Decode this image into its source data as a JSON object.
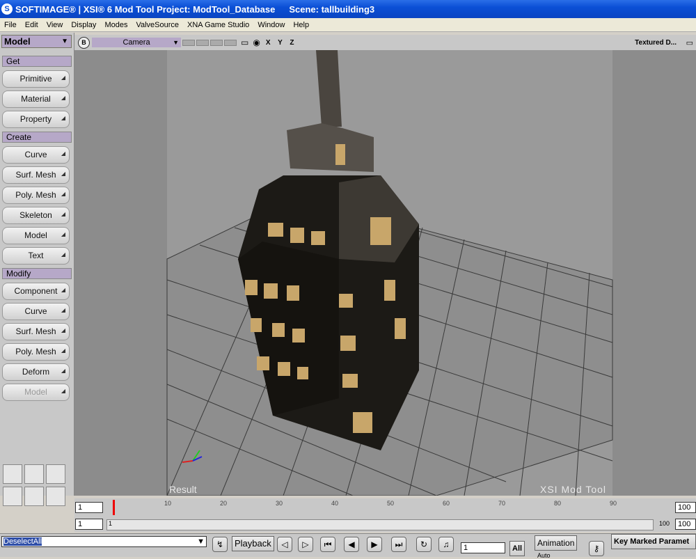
{
  "titlebar": {
    "app": "SOFTIMAGE® | XSI® 6 Mod Tool Project: ModTool_Database",
    "scene": "Scene: tallbuilding3"
  },
  "menu": [
    "File",
    "Edit",
    "View",
    "Display",
    "Modes",
    "ValveSource",
    "XNA Game Studio",
    "Window",
    "Help"
  ],
  "left": {
    "mode": "Model",
    "sections": [
      {
        "title": "Get",
        "buttons": [
          "Primitive",
          "Material",
          "Property"
        ]
      },
      {
        "title": "Create",
        "buttons": [
          "Curve",
          "Surf. Mesh",
          "Poly. Mesh",
          "Skeleton",
          "Model",
          "Text"
        ]
      },
      {
        "title": "Modify",
        "buttons": [
          "Component",
          "Curve",
          "Surf. Mesh",
          "Poly. Mesh",
          "Deform",
          "Model"
        ]
      }
    ]
  },
  "viewport": {
    "b_label": "B",
    "camera": "Camera",
    "axes": "X Y Z",
    "display_mode": "Textured D...",
    "result_label": "Result",
    "watermark": "XSI Mod Tool"
  },
  "timeline": {
    "start_field": "1",
    "end_field": "100",
    "ticks": [
      "10",
      "20",
      "30",
      "40",
      "50",
      "60",
      "70",
      "80",
      "90"
    ],
    "range_start": "1",
    "range_label_start": "1",
    "range_end": "100",
    "range_end_field": "100"
  },
  "bottom": {
    "command": "DeselectAll",
    "playback": "Playback",
    "frame": "1",
    "all": "All",
    "animation": "Animation",
    "auto": "Auto",
    "key_marked": "Key Marked Paramet"
  }
}
